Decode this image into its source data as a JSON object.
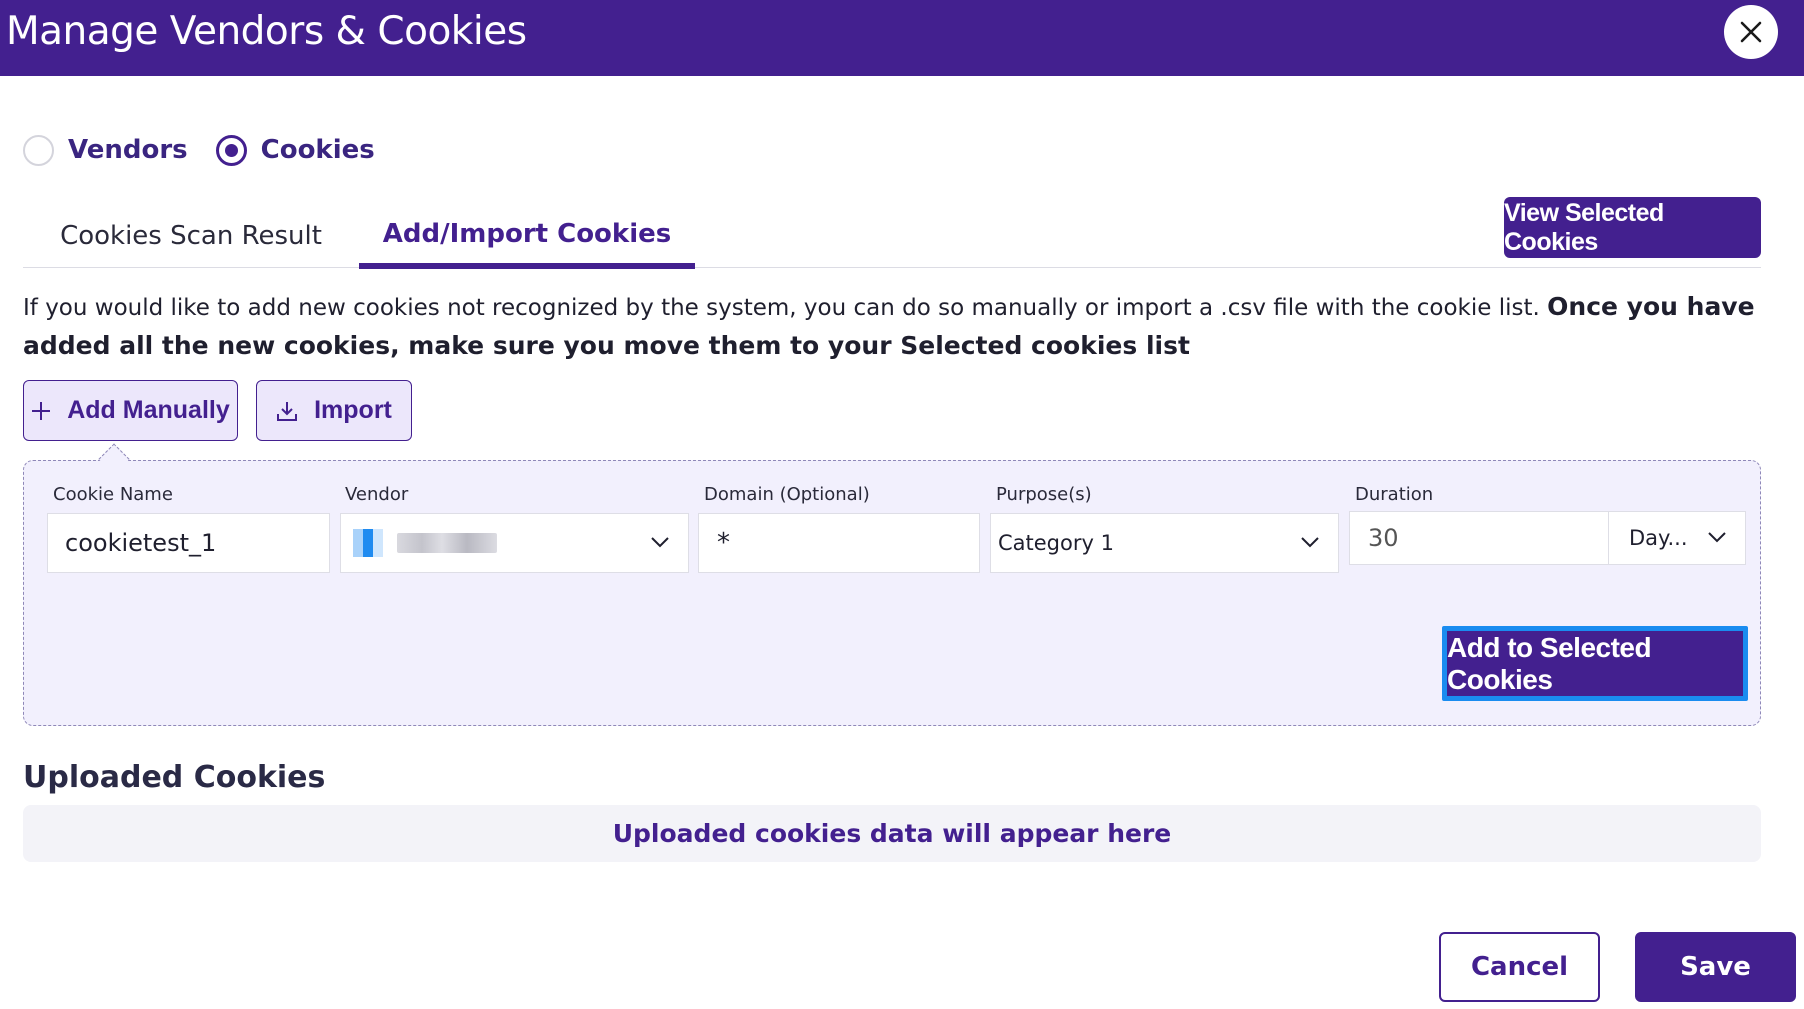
{
  "header": {
    "title": "Manage Vendors & Cookies",
    "close_icon": "close-icon"
  },
  "mode": {
    "options": [
      {
        "label": "Vendors",
        "checked": false
      },
      {
        "label": "Cookies",
        "checked": true
      }
    ]
  },
  "tabs": [
    {
      "label": "Cookies Scan Result",
      "active": false
    },
    {
      "label": "Add/Import Cookies",
      "active": true
    }
  ],
  "view_selected_label": "View Selected Cookies",
  "instructions": {
    "text": "If you would like to add new cookies not recognized by the system, you can do so manually or import a .csv file with the cookie list.",
    "emphasis": "Once you have added all the new cookies, make sure you move them to your Selected cookies list"
  },
  "actions": {
    "add_manually": {
      "label": "Add Manually",
      "icon": "plus-icon"
    },
    "import": {
      "label": "Import",
      "icon": "download-icon"
    }
  },
  "form": {
    "cookie_name": {
      "label": "Cookie Name",
      "value": "cookietest_1"
    },
    "vendor": {
      "label": "Vendor",
      "logo_icon": "vendor-logo-icon",
      "icon": "chevron-down-icon"
    },
    "domain": {
      "label": "Domain (Optional)",
      "value": "*"
    },
    "purposes": {
      "label": "Purpose(s)",
      "value": "Category 1",
      "icon": "chevron-down-icon"
    },
    "duration": {
      "label": "Duration",
      "value": "30",
      "unit": "Day...",
      "icon": "chevron-down-icon"
    },
    "add_button": "Add to Selected Cookies"
  },
  "uploaded": {
    "title": "Uploaded Cookies",
    "empty_message": "Uploaded cookies data will appear here"
  },
  "footer": {
    "cancel": "Cancel",
    "save": "Save"
  },
  "colors": {
    "primary": "#43208f",
    "panel_bg": "#f2f0fd",
    "focus_ring": "#1a8cf0",
    "button_light_bg": "#ece7fb"
  }
}
